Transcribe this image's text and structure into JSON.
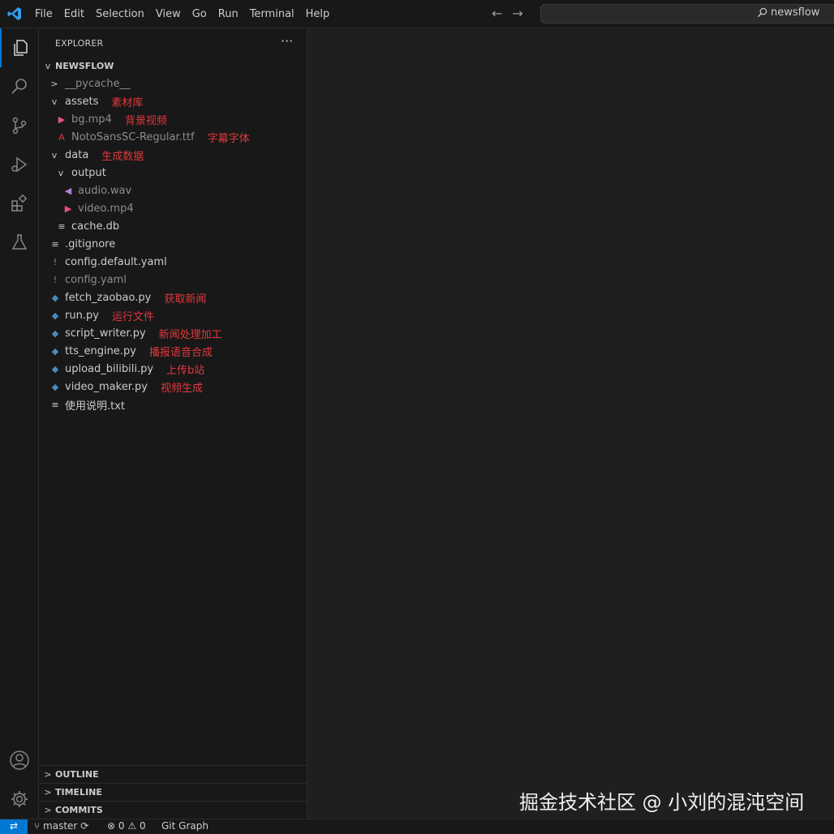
{
  "menu": [
    "File",
    "Edit",
    "Selection",
    "View",
    "Go",
    "Run",
    "Terminal",
    "Help"
  ],
  "search": {
    "label": "newsflow"
  },
  "sidebar": {
    "title": "EXPLORER",
    "more": "···",
    "root": "NEWSFLOW",
    "tree": [
      {
        "name": "__pycache__",
        "chev": ">",
        "dim": true,
        "icon": ""
      },
      {
        "name": "assets",
        "chev": "v",
        "annotation": "素材库",
        "icon": ""
      },
      {
        "name": "bg.mp4",
        "icon": "▶",
        "icon_color": "#e8507a",
        "dim": true,
        "annotation": "背景视频"
      },
      {
        "name": "NotoSansSC-Regular.ttf",
        "icon": "A",
        "icon_color": "#e0393e",
        "dim": true,
        "annotation": "字幕字体"
      },
      {
        "name": "data",
        "chev": "v",
        "annotation": "生成数据",
        "icon": ""
      },
      {
        "name": "output",
        "chev": "v",
        "icon": ""
      },
      {
        "name": "audio.wav",
        "icon": "◀",
        "icon_color": "#b180d7",
        "dim": true
      },
      {
        "name": "video.mp4",
        "icon": "▶",
        "icon_color": "#e8507a",
        "dim": true
      },
      {
        "name": "cache.db",
        "icon": "≡",
        "icon_color": "#cccccc"
      },
      {
        "name": ".gitignore",
        "icon": "≡",
        "icon_color": "#cccccc"
      },
      {
        "name": "config.default.yaml",
        "icon": "!",
        "icon_color": "#a074c4"
      },
      {
        "name": "config.yaml",
        "icon": "!",
        "icon_color": "#a074c4",
        "dim": true
      },
      {
        "name": "fetch_zaobao.py",
        "icon": "◆",
        "icon_color": "#4b8bbe",
        "annotation": "获取新闻"
      },
      {
        "name": "run.py",
        "icon": "◆",
        "icon_color": "#4b8bbe",
        "annotation": "运行文件"
      },
      {
        "name": "script_writer.py",
        "icon": "◆",
        "icon_color": "#4b8bbe",
        "annotation": "新闻处理加工"
      },
      {
        "name": "tts_engine.py",
        "icon": "◆",
        "icon_color": "#4b8bbe",
        "annotation": "播报语音合成"
      },
      {
        "name": "upload_bilibili.py",
        "icon": "◆",
        "icon_color": "#4b8bbe",
        "annotation": "上传b站"
      },
      {
        "name": "video_maker.py",
        "icon": "◆",
        "icon_color": "#4b8bbe",
        "annotation": "视频生成"
      },
      {
        "name": "使用说明.txt",
        "icon": "≡",
        "icon_color": "#cccccc"
      }
    ],
    "panels": [
      "OUTLINE",
      "TIMELINE",
      "COMMITS"
    ]
  },
  "statusbar": {
    "branch": "master",
    "errors": "0",
    "warnings": "0",
    "git_graph": "Git Graph"
  },
  "watermark": "掘金技术社区 @ 小刘的混沌空间"
}
